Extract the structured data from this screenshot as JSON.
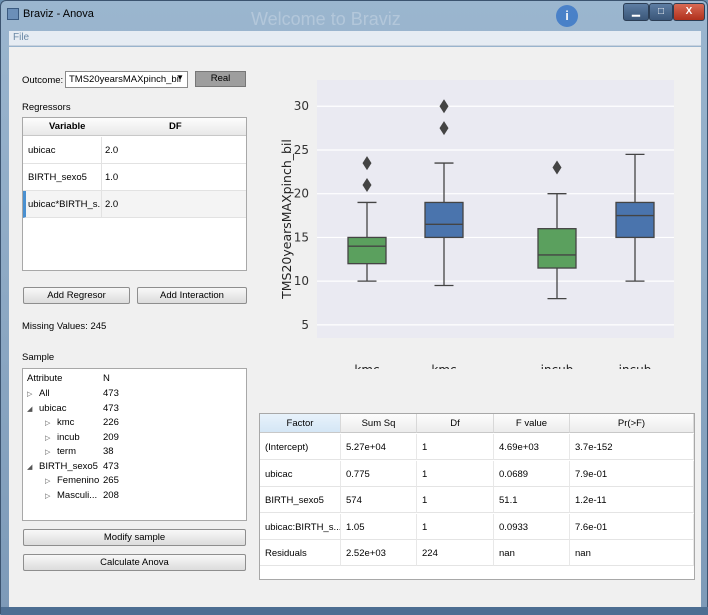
{
  "window": {
    "title": "Braviz - Anova",
    "background_title": "Welcome to Braviz",
    "info_badge": "i"
  },
  "window_buttons": {
    "minimize": "▁",
    "maximize": "□",
    "close": "X"
  },
  "menu": {
    "file": "File"
  },
  "outcome": {
    "label": "Outcome:",
    "value": "TMS20yearsMAXpinch_bil",
    "real_button": "Real"
  },
  "regressors": {
    "title": "Regressors",
    "headers": [
      "Variable",
      "DF"
    ],
    "rows": [
      {
        "variable": "ubicac",
        "df": "2.0"
      },
      {
        "variable": "BIRTH_sexo5",
        "df": "1.0"
      },
      {
        "variable": "ubicac*BIRTH_s...",
        "df": "2.0"
      }
    ],
    "add_regressor": "Add Regresor",
    "add_interaction": "Add Interaction",
    "missing_values": "Missing Values: 245"
  },
  "sample": {
    "title": "Sample",
    "headers": [
      "Attribute",
      "N"
    ],
    "rows": [
      {
        "arrow": "▷",
        "label": "All",
        "n": "473",
        "level": 0
      },
      {
        "arrow": "◢",
        "label": "ubicac",
        "n": "473",
        "level": 0
      },
      {
        "arrow": "▷",
        "label": "kmc",
        "n": "226",
        "level": 1
      },
      {
        "arrow": "▷",
        "label": "incub",
        "n": "209",
        "level": 1
      },
      {
        "arrow": "▷",
        "label": "term",
        "n": "38",
        "level": 1
      },
      {
        "arrow": "◢",
        "label": "BIRTH_sexo5",
        "n": "473",
        "level": 0
      },
      {
        "arrow": "▷",
        "label": "Femenino",
        "n": "265",
        "level": 1
      },
      {
        "arrow": "▷",
        "label": "Masculi...",
        "n": "208",
        "level": 1
      }
    ],
    "modify_sample": "Modify sample",
    "calculate_anova": "Calculate Anova"
  },
  "chart_data": {
    "type": "box",
    "ylabel": "TMS20yearsMAXpinch_bil",
    "ylim": [
      3.5,
      33
    ],
    "yticks": [
      5,
      10,
      15,
      20,
      25,
      30
    ],
    "grid": true,
    "categories": [
      "kmc\nFemenino",
      "kmc\nMasculino",
      "incub\nFemenino",
      "incub\nMasculino"
    ],
    "boxes": [
      {
        "label_top": "kmc",
        "label_bottom": "Femenino",
        "min": 10,
        "q1": 12,
        "median": 14,
        "q3": 15,
        "max": 19,
        "outliers": [
          21,
          23.5
        ],
        "color": "#5ba05e"
      },
      {
        "label_top": "kmc",
        "label_bottom": "Masculino",
        "min": 9.5,
        "q1": 15,
        "median": 16.5,
        "q3": 19,
        "max": 23.5,
        "outliers": [
          27.5,
          30
        ],
        "color": "#4a74ad"
      },
      {
        "label_top": "incub",
        "label_bottom": "Femenino",
        "min": 8,
        "q1": 11.5,
        "median": 13,
        "q3": 16,
        "max": 20,
        "outliers": [
          23
        ],
        "color": "#5ba05e"
      },
      {
        "label_top": "incub",
        "label_bottom": "Masculino",
        "min": 10,
        "q1": 15,
        "median": 17.5,
        "q3": 19,
        "max": 24.5,
        "outliers": [],
        "color": "#4a74ad"
      }
    ]
  },
  "anova": {
    "headers": [
      "Factor",
      "Sum Sq",
      "Df",
      "F value",
      "Pr(>F)"
    ],
    "rows": [
      [
        "(Intercept)",
        "5.27e+04",
        "1",
        "4.69e+03",
        "3.7e-152"
      ],
      [
        "ubicac",
        "0.775",
        "1",
        "0.0689",
        "7.9e-01"
      ],
      [
        "BIRTH_sexo5",
        "574",
        "1",
        "51.1",
        "1.2e-11"
      ],
      [
        "ubicac:BIRTH_s...",
        "1.05",
        "1",
        "0.0933",
        "7.6e-01"
      ],
      [
        "Residuals",
        "2.52e+03",
        "224",
        "nan",
        "nan"
      ]
    ]
  }
}
